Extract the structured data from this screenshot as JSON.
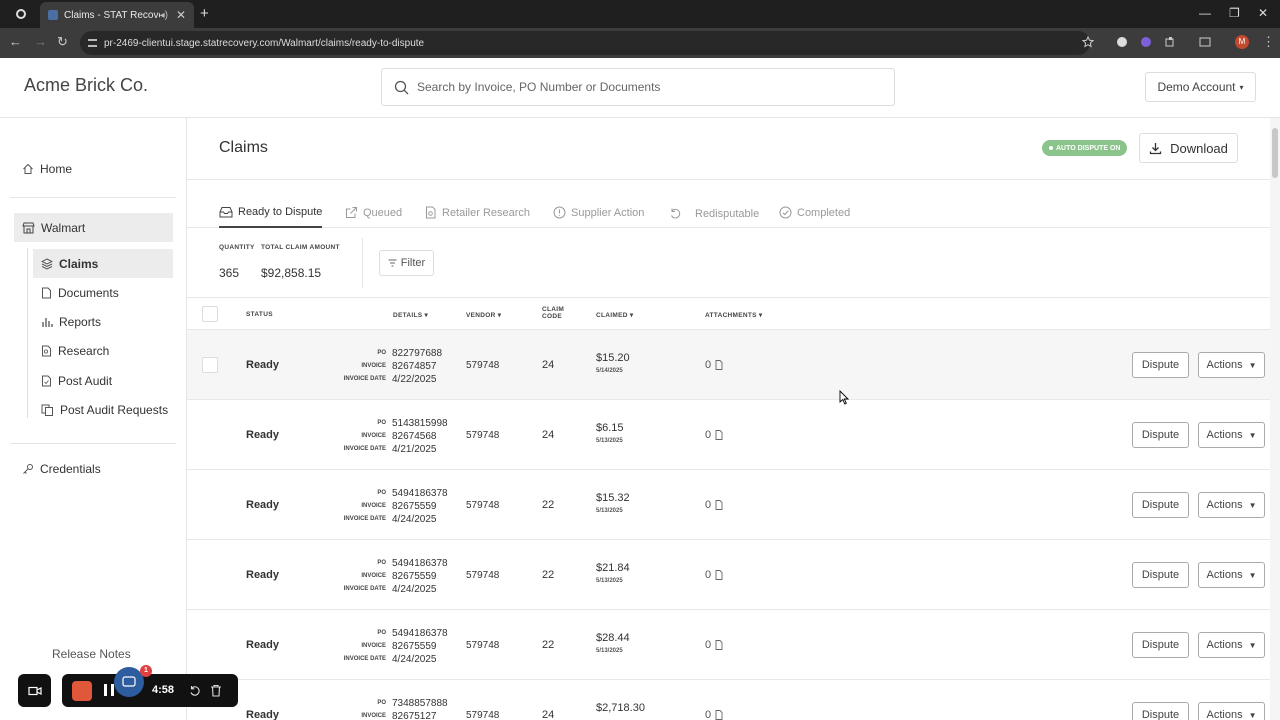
{
  "browser": {
    "tab_title": "Claims - STAT Recovery",
    "url": "pr-2469-clientui.stage.statrecovery.com/Walmart/claims/ready-to-dispute",
    "profile_initial": "M"
  },
  "header": {
    "brand": "Acme Brick Co.",
    "search_placeholder": "Search by Invoice, PO Number or Documents",
    "account_label": "Demo Account"
  },
  "sidebar": {
    "home": "Home",
    "group": "Walmart",
    "items": [
      "Claims",
      "Documents",
      "Reports",
      "Research",
      "Post Audit",
      "Post Audit Requests"
    ],
    "credentials": "Credentials",
    "release_notes": "Release Notes"
  },
  "page": {
    "title": "Claims",
    "auto_dispute_badge": "AUTO DISPUTE ON",
    "download_label": "Download",
    "tabs": [
      "Ready to Dispute",
      "Queued",
      "Retailer Research",
      "Supplier Action",
      "Redisputable",
      "Completed"
    ],
    "summary": {
      "quantity_label": "QUANTITY",
      "quantity_value": "365",
      "total_label": "TOTAL CLAIM AMOUNT",
      "total_value": "$92,858.15"
    },
    "filter_label": "Filter"
  },
  "table": {
    "headers": {
      "status": "STATUS",
      "details": "DETAILS",
      "vendor": "VENDOR",
      "claim_code_1": "CLAIM",
      "claim_code_2": "CODE",
      "claimed": "CLAIMED",
      "attachments": "ATTACHMENTS"
    },
    "detail_labels": {
      "po": "PO",
      "invoice": "INVOICE",
      "invoice_date": "INVOICE DATE"
    },
    "dispute_label": "Dispute",
    "actions_label": "Actions",
    "rows": [
      {
        "status": "Ready",
        "po": "822797688",
        "invoice": "82674857",
        "invoice_date": "4/22/2025",
        "vendor": "579748",
        "code": "24",
        "amount": "$15.20",
        "claimed_date": "5/14/2025",
        "attachments": "0"
      },
      {
        "status": "Ready",
        "po": "5143815998",
        "invoice": "82674568",
        "invoice_date": "4/21/2025",
        "vendor": "579748",
        "code": "24",
        "amount": "$6.15",
        "claimed_date": "5/13/2025",
        "attachments": "0"
      },
      {
        "status": "Ready",
        "po": "5494186378",
        "invoice": "82675559",
        "invoice_date": "4/24/2025",
        "vendor": "579748",
        "code": "22",
        "amount": "$15.32",
        "claimed_date": "5/13/2025",
        "attachments": "0"
      },
      {
        "status": "Ready",
        "po": "5494186378",
        "invoice": "82675559",
        "invoice_date": "4/24/2025",
        "vendor": "579748",
        "code": "22",
        "amount": "$21.84",
        "claimed_date": "5/13/2025",
        "attachments": "0"
      },
      {
        "status": "Ready",
        "po": "5494186378",
        "invoice": "82675559",
        "invoice_date": "4/24/2025",
        "vendor": "579748",
        "code": "22",
        "amount": "$28.44",
        "claimed_date": "5/13/2025",
        "attachments": "0"
      },
      {
        "status": "Ready",
        "po": "7348857888",
        "invoice": "82675127",
        "invoice_date": "",
        "vendor": "579748",
        "code": "24",
        "amount": "$2,718.30",
        "claimed_date": "",
        "attachments": "0"
      }
    ]
  },
  "recorder": {
    "time": "4:58",
    "badge": "1"
  }
}
